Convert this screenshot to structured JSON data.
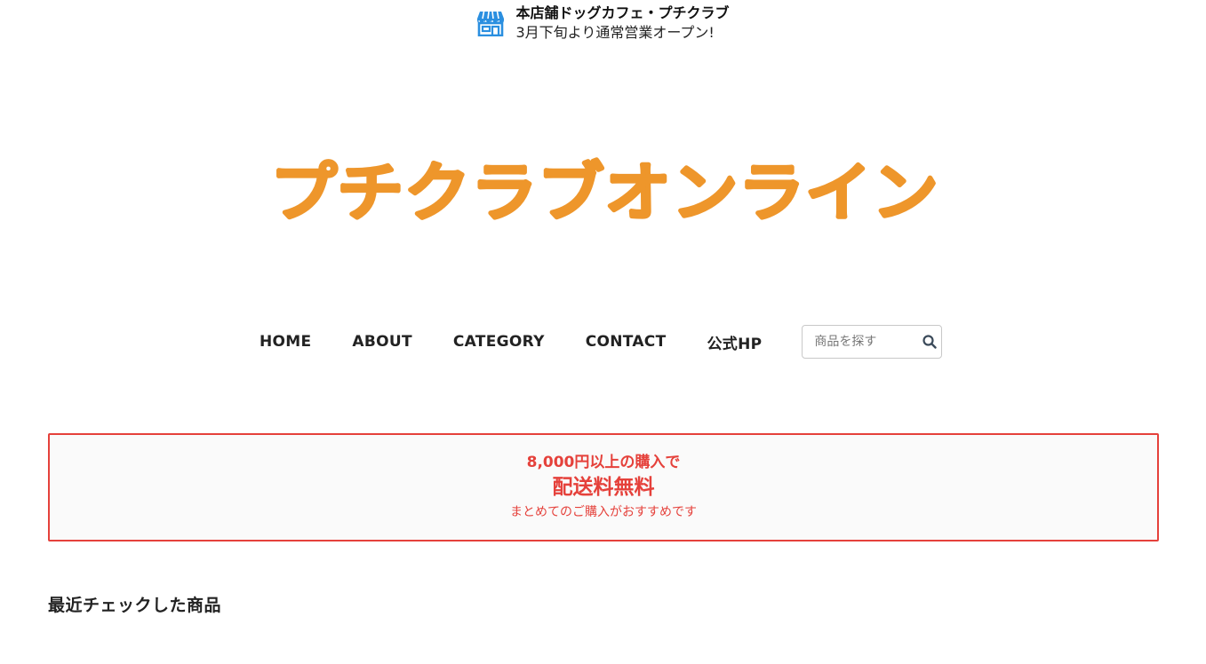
{
  "announcement": {
    "icon": "store-icon",
    "title": "本店舗ドッグカフェ・プチクラブ",
    "subtitle": "3月下旬より通常営業オープン!"
  },
  "logo": {
    "text": "プチクラブオンライン",
    "color": "#ee962b"
  },
  "nav": {
    "items": [
      {
        "label": "HOME"
      },
      {
        "label": "ABOUT"
      },
      {
        "label": "CATEGORY"
      },
      {
        "label": "CONTACT"
      },
      {
        "label": "公式HP"
      }
    ]
  },
  "search": {
    "placeholder": "商品を探す",
    "value": "",
    "icon": "search-icon"
  },
  "promo": {
    "line1": "8,000円以上の購入で",
    "line2": "配送料無料",
    "line3": "まとめてのご購入がおすすめです",
    "accent_color": "#e5413b"
  },
  "recent": {
    "heading": "最近チェックした商品"
  }
}
